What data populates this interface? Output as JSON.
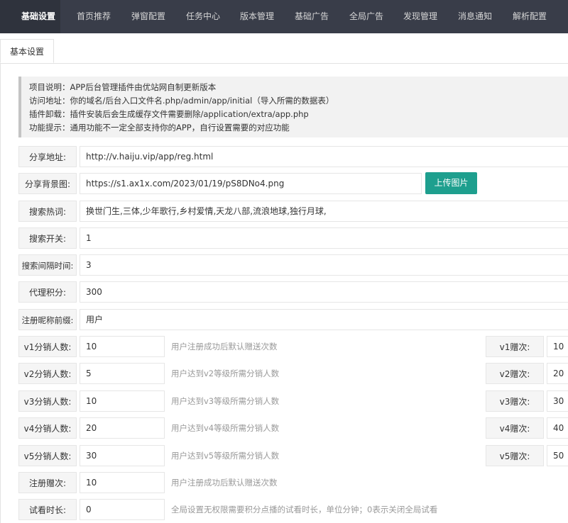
{
  "nav": {
    "items": [
      {
        "label": "基础设置",
        "active": true
      },
      {
        "label": "首页推荐"
      },
      {
        "label": "弹窗配置"
      },
      {
        "label": "任务中心"
      },
      {
        "label": "版本管理"
      },
      {
        "label": "基础广告"
      },
      {
        "label": "全局广告"
      },
      {
        "label": "发现管理"
      },
      {
        "label": "消息通知"
      },
      {
        "label": "解析配置"
      }
    ]
  },
  "tab": {
    "label": "基本设置"
  },
  "notice": {
    "lines": [
      "项目说明：APP后台管理插件由优站网自制更新版本",
      "访问地址：你的域名/后台入口文件名.php/admin/app/initial（导入所需的数据表）",
      "插件卸载：插件安装后会生成缓存文件需要删除/application/extra/app.php",
      "功能提示：通用功能不一定全部支持你的APP，自行设置需要的对应功能"
    ]
  },
  "form": {
    "share_url": {
      "label": "分享地址:",
      "value": "http://v.haiju.vip/app/reg.html"
    },
    "share_bg": {
      "label": "分享背景图:",
      "value": "https://s1.ax1x.com/2023/01/19/pS8DNo4.png",
      "button": "上传图片"
    },
    "hot_search": {
      "label": "搜索热词:",
      "value": "换世门生,三体,少年歌行,乡村爱情,天龙八部,流浪地球,独行月球,"
    },
    "search_switch": {
      "label": "搜索开关:",
      "value": "1"
    },
    "search_interval": {
      "label": "搜索间隔时间:",
      "value": "3"
    },
    "agent_points": {
      "label": "代理积分:",
      "value": "300"
    },
    "nick_prefix": {
      "label": "注册昵称前缀:",
      "value": "用户"
    },
    "levels": [
      {
        "label": "v1分销人数:",
        "value": "10",
        "hint": "用户注册成功后默认赠送次数",
        "gift_label": "v1赠次:",
        "gift_value": "10"
      },
      {
        "label": "v2分销人数:",
        "value": "5",
        "hint": "用户达到v2等级所需分销人数",
        "gift_label": "v2赠次:",
        "gift_value": "20"
      },
      {
        "label": "v3分销人数:",
        "value": "10",
        "hint": "用户达到v3等级所需分销人数",
        "gift_label": "v3赠次:",
        "gift_value": "30"
      },
      {
        "label": "v4分销人数:",
        "value": "20",
        "hint": "用户达到v4等级所需分销人数",
        "gift_label": "v4赠次:",
        "gift_value": "40"
      },
      {
        "label": "v5分销人数:",
        "value": "30",
        "hint": "用户达到v5等级所需分销人数",
        "gift_label": "v5赠次:",
        "gift_value": "50"
      }
    ],
    "reg_gift": {
      "label": "注册赠次:",
      "value": "10",
      "hint": "用户注册成功后默认赠送次数"
    },
    "trial_time": {
      "label": "试看时长:",
      "value": "0",
      "hint": "全局设置无权限需要积分点播的试看时长，单位分钟；0表示关闭全局试看"
    }
  }
}
